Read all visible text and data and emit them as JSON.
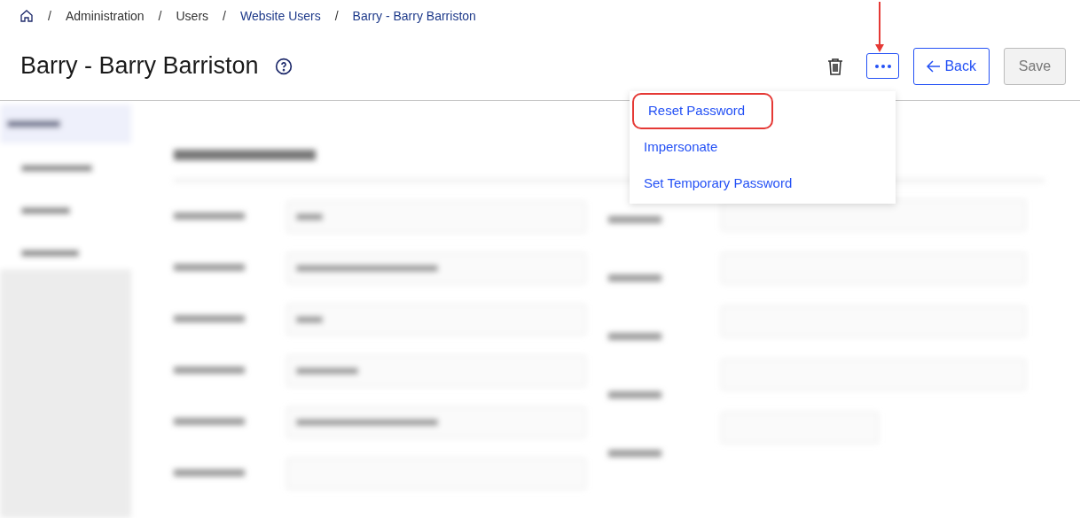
{
  "breadcrumb": [
    {
      "separator": "/",
      "label": "Administration",
      "link": false
    },
    {
      "separator": "/",
      "label": "Users",
      "link": false
    },
    {
      "separator": "/",
      "label": "Website Users",
      "link": true
    },
    {
      "separator": "/",
      "label": "Barry - Barry Barriston",
      "link": true
    }
  ],
  "title": "Barry - Barry Barriston",
  "more_button": {
    "annotated": true,
    "expanded": true
  },
  "back_button": {
    "label": "Back"
  },
  "save_button": {
    "label": "Save",
    "disabled": true
  },
  "menu": [
    {
      "label": "Reset Password",
      "highlighted": true
    },
    {
      "label": "Impersonate",
      "highlighted": false
    },
    {
      "label": "Set Temporary Password",
      "highlighted": false
    }
  ]
}
